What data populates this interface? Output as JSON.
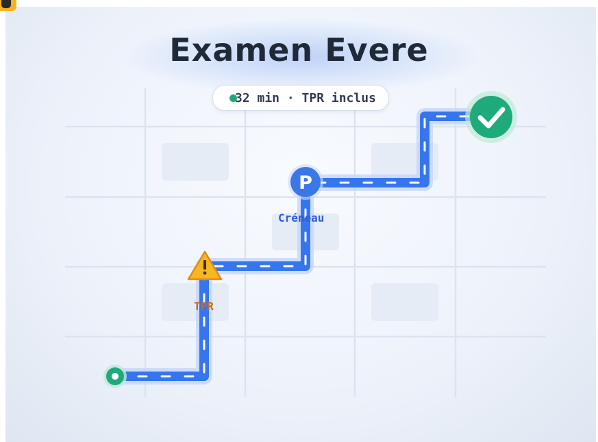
{
  "title": "Examen Evere",
  "summary": {
    "text": "32 min · TPR inclus",
    "dot_color": "#1eaa7a"
  },
  "waypoints": {
    "parking": {
      "glyph": "P",
      "label": "Créneau",
      "color": "#3a78e8"
    },
    "warning": {
      "glyph": "!",
      "label": "TPR",
      "color": "#f6b820"
    },
    "destination": {
      "glyph": "✓",
      "color": "#1eaa7a"
    },
    "start": {
      "color": "#1eaa7a"
    }
  },
  "colors": {
    "route": "#3576ee",
    "route_halo": "#c5d6fb",
    "grid": "#dde3ee",
    "block": "#e8eef7",
    "label_blue": "#2f5fd2",
    "label_orange": "#c86a1c",
    "title": "#1f2937"
  }
}
